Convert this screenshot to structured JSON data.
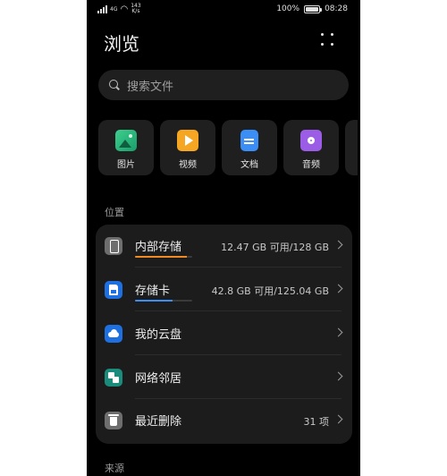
{
  "status_bar": {
    "network_type": "4G",
    "net_speed_value": "143",
    "net_speed_unit": "K/s",
    "battery": "100%",
    "time": "08:28"
  },
  "header": {
    "title": "浏览",
    "more_icon": "more-dots-icon"
  },
  "search": {
    "placeholder": "搜索文件",
    "icon": "search-icon"
  },
  "categories": [
    {
      "label": "图片",
      "icon": "image-icon",
      "color": "#2fbf7f"
    },
    {
      "label": "视频",
      "icon": "video-icon",
      "color": "#f5a623"
    },
    {
      "label": "文档",
      "icon": "document-icon",
      "color": "#3a8ef6"
    },
    {
      "label": "音频",
      "icon": "audio-icon",
      "color": "#9b5de5"
    }
  ],
  "locations": {
    "section_title": "位置",
    "items": [
      {
        "label": "内部存储",
        "value": "12.47 GB 可用/128 GB",
        "icon": "phone-storage-icon",
        "usage_fraction": 0.9,
        "bar_color": "#f08a24"
      },
      {
        "label": "存储卡",
        "value": "42.8 GB 可用/125.04 GB",
        "icon": "sd-card-icon",
        "usage_fraction": 0.66,
        "bar_color": "#3a8ef6"
      },
      {
        "label": "我的云盘",
        "value": "",
        "icon": "cloud-icon"
      },
      {
        "label": "网络邻居",
        "value": "",
        "icon": "network-neighborhood-icon"
      },
      {
        "label": "最近删除",
        "value": "31 项",
        "icon": "trash-icon"
      }
    ]
  },
  "sources": {
    "section_title": "来源"
  }
}
